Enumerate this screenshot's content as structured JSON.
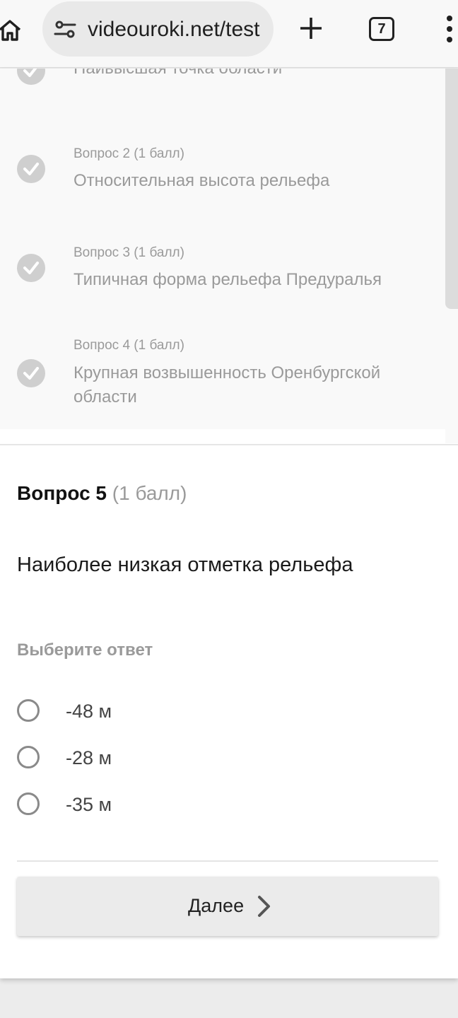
{
  "browser": {
    "url": "videouroki.net/test",
    "tab_count": "7"
  },
  "previous_questions": [
    {
      "label": "",
      "text": "Наивысшая точка области"
    },
    {
      "label": "Вопрос 2 (1 балл)",
      "text": "Относительная высота рельефа"
    },
    {
      "label": "Вопрос 3 (1 балл)",
      "text": "Типичная форма рельефа Предуралья"
    },
    {
      "label": "Вопрос 4 (1 балл)",
      "text": "Крупная возвышенность Оренбургской области"
    }
  ],
  "current_question": {
    "title": "Вопрос 5",
    "points": "(1 балл)",
    "text": "Наиболее низкая отметка рельефа",
    "prompt": "Выберите ответ",
    "options": [
      "-48 м",
      "-28 м",
      "-35 м"
    ]
  },
  "next_button": {
    "label": "Далее"
  },
  "colors": {
    "muted_text": "#9a9a9a",
    "check_circle": "#cfcfcf",
    "button_bg": "#ebebeb"
  },
  "icons": {
    "home": "home-icon",
    "site_settings": "tune-icon",
    "new_tab": "plus-icon",
    "menu": "more-vertical-icon",
    "done": "check-icon",
    "next": "chevron-right-icon"
  }
}
